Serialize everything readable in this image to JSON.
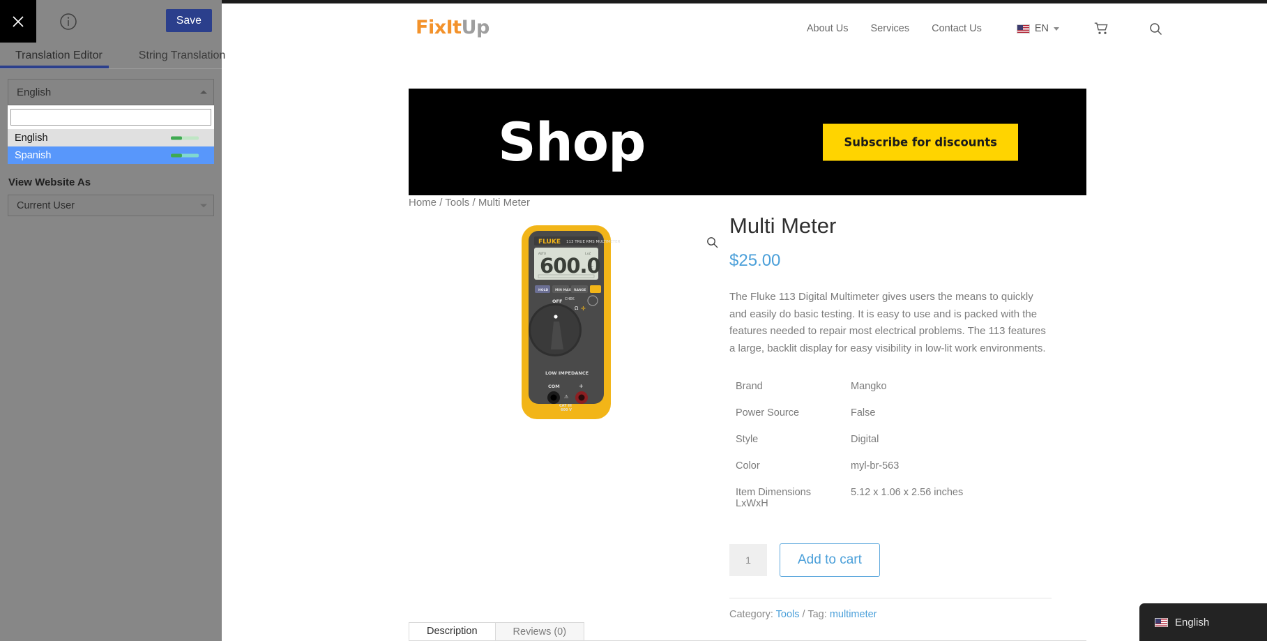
{
  "sidebar": {
    "close_icon": "close-icon",
    "info_icon": "info-circle-icon",
    "save_label": "Save",
    "tabs": [
      {
        "label": "Translation Editor",
        "active": true
      },
      {
        "label": "String Translation",
        "active": false
      }
    ],
    "language_select": {
      "selected": "English",
      "search_value": "",
      "search_placeholder": "",
      "options": [
        {
          "label": "English",
          "state": "hover",
          "progress_pct": 40,
          "progress_color": "#3faa52",
          "track_color": "#bfe6c5"
        },
        {
          "label": "Spanish",
          "state": "selected",
          "progress_pct": 40,
          "progress_color": "#3faa52",
          "track_color": "#7fd8d0"
        }
      ]
    },
    "view_website_as": {
      "label": "View Website As",
      "selected": "Current User"
    }
  },
  "site": {
    "logo": {
      "orange": "FixIt",
      "gray": "Up"
    },
    "nav": [
      {
        "label": "About Us"
      },
      {
        "label": "Services"
      },
      {
        "label": "Contact Us"
      }
    ],
    "lang_picker": {
      "code": "EN",
      "flag": "us-flag-icon"
    },
    "cart_icon": "shopping-cart-icon",
    "search_icon": "search-icon",
    "banner": {
      "title": "Shop",
      "button_label": "Subscribe for discounts",
      "bg_color": "#000000",
      "button_color": "#ffd400"
    },
    "breadcrumb": [
      {
        "label": "Home",
        "link": true
      },
      {
        "label": "Tools",
        "link": true
      },
      {
        "label": "Multi Meter",
        "link": false
      }
    ],
    "breadcrumb_separator": "/",
    "product": {
      "image_alt": "Fluke 113 True RMS Multimeter",
      "image_zoom_icon": "magnifier-icon",
      "title": "Multi Meter",
      "price": "$25.00",
      "description": "The Fluke 113 Digital Multimeter gives users the means to quickly and easily do basic testing. It is easy to use and is packed with the features needed to repair most electrical problems. The 113 features a large, backlit display for easy visibility in low-lit work environments.",
      "attributes": [
        {
          "key": "Brand",
          "value": "Mangko"
        },
        {
          "key": "Power Source",
          "value": "False"
        },
        {
          "key": "Style",
          "value": "Digital"
        },
        {
          "key": "Color",
          "value": "myl-br-563"
        },
        {
          "key": "Item Dimensions LxWxH",
          "value": "5.12 x 1.06 x 2.56 inches"
        }
      ],
      "quantity": "1",
      "add_to_cart_label": "Add to cart",
      "meta": {
        "category_label": "Category:",
        "category_value": "Tools",
        "separator": "/",
        "tag_label": "Tag:",
        "tag_value": "multimeter"
      }
    },
    "product_tabs": [
      {
        "label": "Description",
        "active": true
      },
      {
        "label": "Reviews (0)",
        "active": false
      }
    ],
    "language_widget": {
      "label": "English",
      "flag": "us-flag-icon"
    }
  }
}
